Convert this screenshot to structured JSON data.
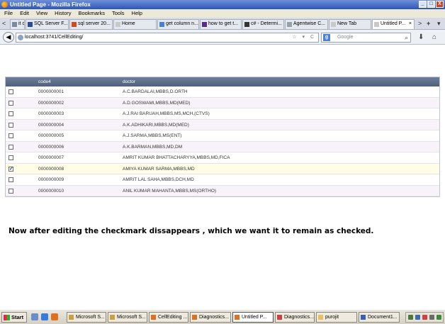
{
  "window": {
    "title": "Untitled Page - Mozilla Firefox",
    "buttons": [
      "_",
      "□",
      "X"
    ]
  },
  "menu": [
    "File",
    "Edit",
    "View",
    "History",
    "Bookmarks",
    "Tools",
    "Help"
  ],
  "tabs": [
    {
      "label": "it col...",
      "icon_color": "#7a8aa0"
    },
    {
      "label": "SQL Server F...",
      "icon_color": "#2a4d9a"
    },
    {
      "label": "sql server 20...",
      "icon_color": "#d04a1a"
    },
    {
      "label": "Home",
      "icon_color": "#c9c9c9"
    },
    {
      "label": "get column n...",
      "icon_color": "#4a7fd6"
    },
    {
      "label": "how to get t...",
      "icon_color": "#5a2a8a"
    },
    {
      "label": "c# - Determi...",
      "icon_color": "#333333"
    },
    {
      "label": "Agentwise C...",
      "icon_color": "#9aa0a8"
    },
    {
      "label": "New Tab",
      "icon_color": "#c9c9c9"
    },
    {
      "label": "Untitled P...",
      "icon_color": "#c9c9c9",
      "active": true
    }
  ],
  "tab_controls": {
    "scroll_left": "<",
    "scroll_right": ">",
    "new_tab": "+",
    "list_all": "▾"
  },
  "nav": {
    "back": "◀",
    "url": "localhost:3741/CellEditing/",
    "url_icons": "☆ ▾ C",
    "search_placeholder": "Google",
    "search_engine_letter": "g",
    "search_icon": "⌕",
    "download_icon": "⬇",
    "home_icon": "⌂"
  },
  "grid": {
    "columns": [
      "code4",
      "doctor"
    ],
    "rows": [
      {
        "code": "0000000001",
        "doctor": "A.C.BARDALAI,MBBS,D.ORTH",
        "checked": false
      },
      {
        "code": "0000000002",
        "doctor": "A.D.GOSWAMI,MBBS,MD(MED)",
        "checked": false
      },
      {
        "code": "0000000003",
        "doctor": "A.J.RAI BARUAH,MBBS,MS,MCH,(CTVS)",
        "checked": false
      },
      {
        "code": "0000000004",
        "doctor": "A.K.ADHIKARI,MBBS,MD(MED)",
        "checked": false
      },
      {
        "code": "0000000005",
        "doctor": "A.J.SARMA,MBBS,MS(ENT)",
        "checked": false
      },
      {
        "code": "0000000006",
        "doctor": "A.K.BARMAN,MBBS,MD,DM",
        "checked": false
      },
      {
        "code": "0000000007",
        "doctor": "AMRIT KUMAR BHATTACHARYYA,MBBS,MD,FICA",
        "checked": false
      },
      {
        "code": "0000000008",
        "doctor": "AMIYA KUMAR SARMA,MBBS,MD",
        "checked": true
      },
      {
        "code": "0000000009",
        "doctor": "AMRIT LAL SAHA,MBBS,DCH,MD",
        "checked": false
      },
      {
        "code": "0000000010",
        "doctor": "ANIL KUMAR MAHANTA,MBBS,MS(ORTHO)",
        "checked": false
      }
    ]
  },
  "note": "Now after editing the checkmark dissappears  , which we want it to remain as checked.",
  "taskbar": {
    "start": "Start",
    "items": [
      {
        "label": "Microsoft S...",
        "icon_color": "#c9a040"
      },
      {
        "label": "Microsoft S...",
        "icon_color": "#c9a040"
      },
      {
        "label": "CellEditing ...",
        "icon_color": "#e07020"
      },
      {
        "label": "Diagnostics...",
        "icon_color": "#e07020"
      },
      {
        "label": "Untitled P...",
        "icon_color": "#e07020",
        "active": true
      },
      {
        "label": "Diagnostics...",
        "icon_color": "#d04040"
      },
      {
        "label": "purojit",
        "icon_color": "#e8c060"
      },
      {
        "label": "Document1...",
        "icon_color": "#3a5fb0"
      }
    ]
  }
}
